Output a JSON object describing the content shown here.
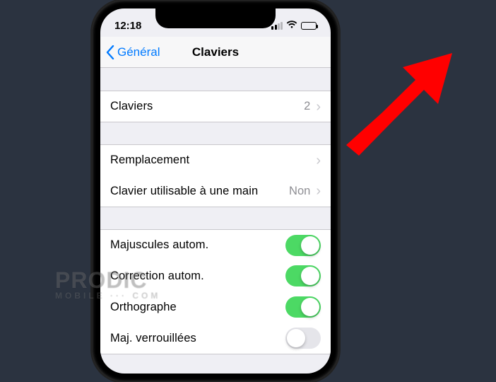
{
  "status": {
    "time": "12:18"
  },
  "nav": {
    "back_label": "Général",
    "title": "Claviers"
  },
  "group1": {
    "claviers": {
      "label": "Claviers",
      "value": "2"
    }
  },
  "group2": {
    "remplacement": {
      "label": "Remplacement"
    },
    "one_hand": {
      "label": "Clavier utilisable à une main",
      "value": "Non"
    }
  },
  "group3": {
    "autocap": {
      "label": "Majuscules autom.",
      "on": true
    },
    "autocorrect": {
      "label": "Correction autom.",
      "on": true
    },
    "spellcheck": {
      "label": "Orthographe",
      "on": true
    },
    "capslock": {
      "label": "Maj. verrouillées",
      "on": false
    }
  },
  "watermark": {
    "line1": "PRODIC",
    "line2": "MOBILE ··· COM"
  },
  "colors": {
    "accent": "#007aff",
    "toggle_on": "#4cd964",
    "arrow": "#ff0000"
  }
}
